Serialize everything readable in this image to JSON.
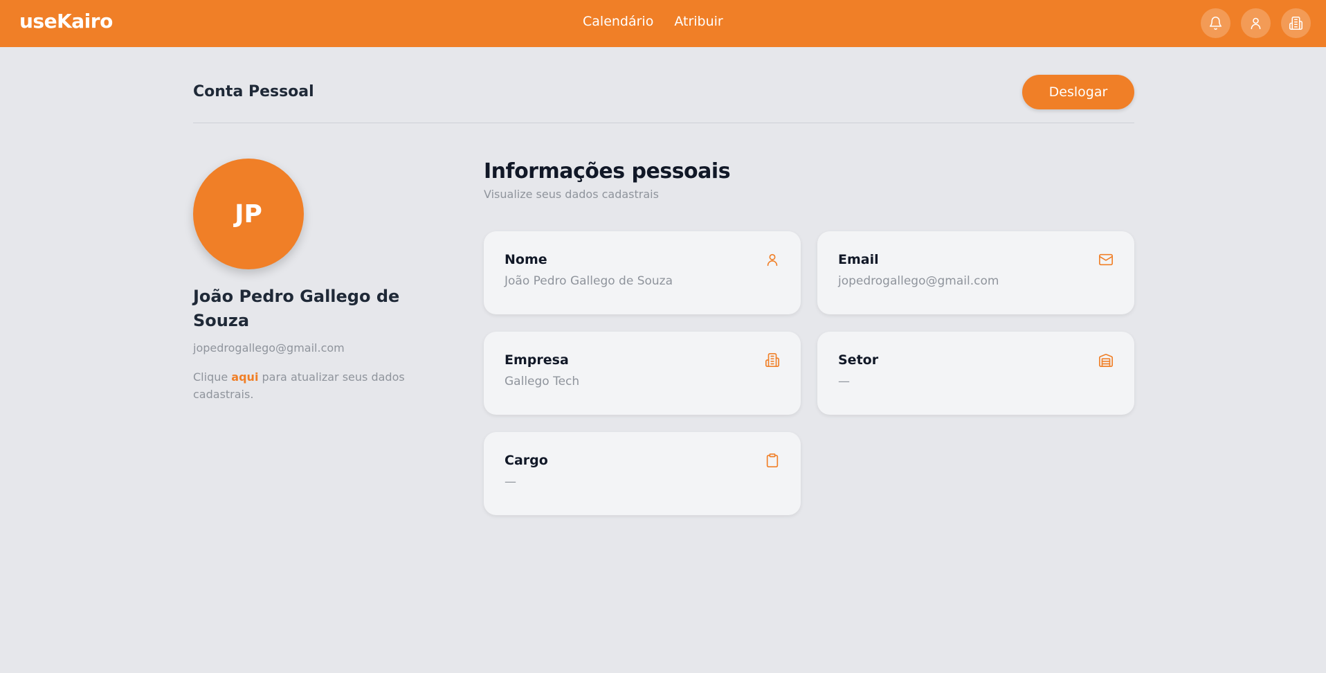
{
  "brand": "useKairo",
  "nav": [
    {
      "label": "Calendário"
    },
    {
      "label": "Atribuir"
    }
  ],
  "top_icons": [
    "bell-icon",
    "user-icon",
    "building-icon"
  ],
  "header": {
    "title": "Conta Pessoal",
    "logout_label": "Deslogar"
  },
  "profile": {
    "initials": "JP",
    "name": "João Pedro Gallego de Souza",
    "email": "jopedrogallego@gmail.com",
    "hint_prefix": "Clique ",
    "hint_link": "aqui",
    "hint_suffix": " para atualizar seus dados cadastrais."
  },
  "info": {
    "title": "Informações pessoais",
    "subtitle": "Visualize seus dados cadastrais",
    "cards": [
      {
        "label": "Nome",
        "value": "João Pedro Gallego de Souza",
        "icon": "user-icon"
      },
      {
        "label": "Email",
        "value": "jopedrogallego@gmail.com",
        "icon": "mail-icon"
      },
      {
        "label": "Empresa",
        "value": "Gallego Tech",
        "icon": "building-icon"
      },
      {
        "label": "Setor",
        "value": "—",
        "icon": "warehouse-icon"
      },
      {
        "label": "Cargo",
        "value": "—",
        "icon": "clipboard-icon"
      }
    ]
  },
  "colors": {
    "accent": "#f07f27",
    "background": "#e6e7eb",
    "card": "#f3f4f6",
    "muted_text": "#8f949c"
  }
}
